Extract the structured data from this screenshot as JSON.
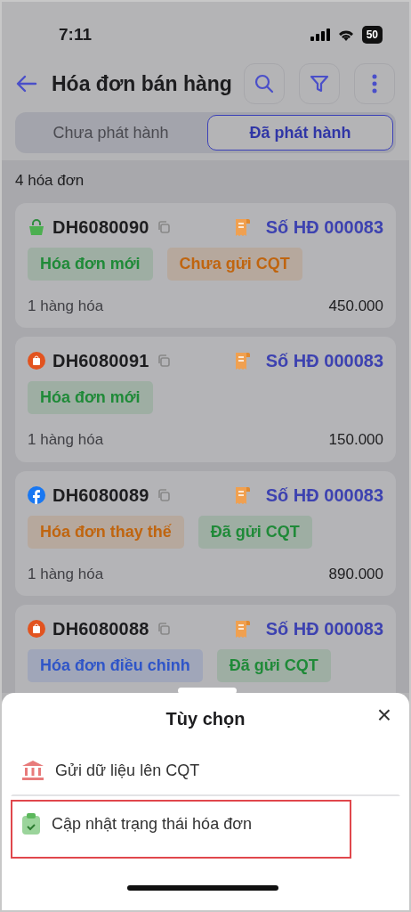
{
  "status_bar": {
    "time": "7:11",
    "battery": "50"
  },
  "header": {
    "title": "Hóa đơn bán hàng"
  },
  "tabs": [
    {
      "label": "Chưa phát hành",
      "selected": false
    },
    {
      "label": "Đã phát hành",
      "selected": true
    }
  ],
  "count": "4 hóa đơn",
  "invoices": [
    {
      "kind": "bag",
      "code": "DH6080090",
      "number": "Số HĐ 000083",
      "tags": [
        {
          "label": "Hóa đơn mới",
          "color": "#1f8a38"
        },
        {
          "label": "Chưa gửi CQT",
          "color": "#c0650f"
        }
      ],
      "items": "1 hàng hóa",
      "total": "450.000"
    },
    {
      "kind": "shop",
      "code": "DH6080091",
      "number": "Số HĐ 000083",
      "tags": [
        {
          "label": "Hóa đơn mới",
          "color": "#1f8a38"
        }
      ],
      "items": "1 hàng hóa",
      "total": "150.000"
    },
    {
      "kind": "facebook",
      "code": "DH6080089",
      "number": "Số HĐ 000083",
      "tags": [
        {
          "label": "Hóa đơn thay thế",
          "color": "#c0650f"
        },
        {
          "label": "Đã gửi CQT",
          "color": "#1f8a38"
        }
      ],
      "items": "1 hàng hóa",
      "total": "890.000"
    },
    {
      "kind": "shop",
      "code": "DH6080088",
      "number": "Số HĐ 000083",
      "tags": [
        {
          "label": "Hóa đơn điều chỉnh",
          "color": "#2f55c8"
        },
        {
          "label": "Đã gửi CQT",
          "color": "#1f8a38"
        }
      ]
    }
  ],
  "sheet": {
    "title": "Tùy chọn",
    "close": "×",
    "options": [
      {
        "kind": "bank",
        "label": "Gửi dữ liệu lên CQT",
        "highlighted": false
      },
      {
        "kind": "clipboard",
        "label": "Cập nhật trạng thái hóa đơn",
        "highlighted": true
      }
    ]
  }
}
